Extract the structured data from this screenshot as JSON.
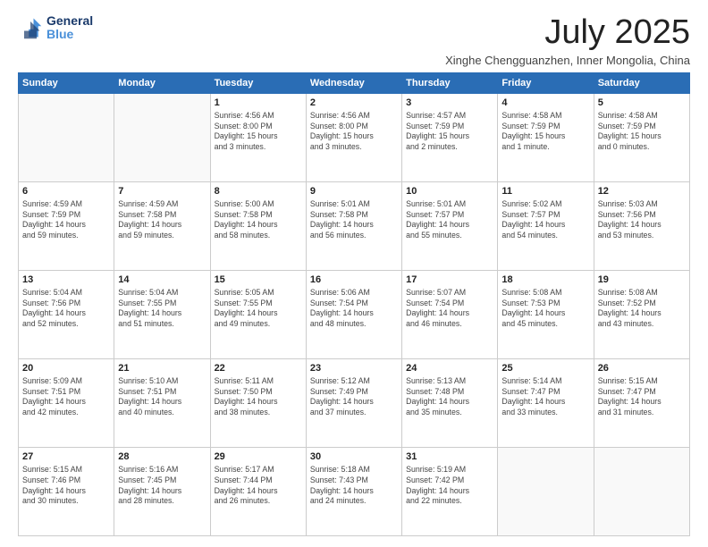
{
  "logo": {
    "line1": "General",
    "line2": "Blue"
  },
  "title": "July 2025",
  "subtitle": "Xinghe Chengguanzhen, Inner Mongolia, China",
  "weekdays": [
    "Sunday",
    "Monday",
    "Tuesday",
    "Wednesday",
    "Thursday",
    "Friday",
    "Saturday"
  ],
  "weeks": [
    [
      {
        "day": null,
        "info": null
      },
      {
        "day": null,
        "info": null
      },
      {
        "day": "1",
        "info": "Sunrise: 4:56 AM\nSunset: 8:00 PM\nDaylight: 15 hours\nand 3 minutes."
      },
      {
        "day": "2",
        "info": "Sunrise: 4:56 AM\nSunset: 8:00 PM\nDaylight: 15 hours\nand 3 minutes."
      },
      {
        "day": "3",
        "info": "Sunrise: 4:57 AM\nSunset: 7:59 PM\nDaylight: 15 hours\nand 2 minutes."
      },
      {
        "day": "4",
        "info": "Sunrise: 4:58 AM\nSunset: 7:59 PM\nDaylight: 15 hours\nand 1 minute."
      },
      {
        "day": "5",
        "info": "Sunrise: 4:58 AM\nSunset: 7:59 PM\nDaylight: 15 hours\nand 0 minutes."
      }
    ],
    [
      {
        "day": "6",
        "info": "Sunrise: 4:59 AM\nSunset: 7:59 PM\nDaylight: 14 hours\nand 59 minutes."
      },
      {
        "day": "7",
        "info": "Sunrise: 4:59 AM\nSunset: 7:58 PM\nDaylight: 14 hours\nand 59 minutes."
      },
      {
        "day": "8",
        "info": "Sunrise: 5:00 AM\nSunset: 7:58 PM\nDaylight: 14 hours\nand 58 minutes."
      },
      {
        "day": "9",
        "info": "Sunrise: 5:01 AM\nSunset: 7:58 PM\nDaylight: 14 hours\nand 56 minutes."
      },
      {
        "day": "10",
        "info": "Sunrise: 5:01 AM\nSunset: 7:57 PM\nDaylight: 14 hours\nand 55 minutes."
      },
      {
        "day": "11",
        "info": "Sunrise: 5:02 AM\nSunset: 7:57 PM\nDaylight: 14 hours\nand 54 minutes."
      },
      {
        "day": "12",
        "info": "Sunrise: 5:03 AM\nSunset: 7:56 PM\nDaylight: 14 hours\nand 53 minutes."
      }
    ],
    [
      {
        "day": "13",
        "info": "Sunrise: 5:04 AM\nSunset: 7:56 PM\nDaylight: 14 hours\nand 52 minutes."
      },
      {
        "day": "14",
        "info": "Sunrise: 5:04 AM\nSunset: 7:55 PM\nDaylight: 14 hours\nand 51 minutes."
      },
      {
        "day": "15",
        "info": "Sunrise: 5:05 AM\nSunset: 7:55 PM\nDaylight: 14 hours\nand 49 minutes."
      },
      {
        "day": "16",
        "info": "Sunrise: 5:06 AM\nSunset: 7:54 PM\nDaylight: 14 hours\nand 48 minutes."
      },
      {
        "day": "17",
        "info": "Sunrise: 5:07 AM\nSunset: 7:54 PM\nDaylight: 14 hours\nand 46 minutes."
      },
      {
        "day": "18",
        "info": "Sunrise: 5:08 AM\nSunset: 7:53 PM\nDaylight: 14 hours\nand 45 minutes."
      },
      {
        "day": "19",
        "info": "Sunrise: 5:08 AM\nSunset: 7:52 PM\nDaylight: 14 hours\nand 43 minutes."
      }
    ],
    [
      {
        "day": "20",
        "info": "Sunrise: 5:09 AM\nSunset: 7:51 PM\nDaylight: 14 hours\nand 42 minutes."
      },
      {
        "day": "21",
        "info": "Sunrise: 5:10 AM\nSunset: 7:51 PM\nDaylight: 14 hours\nand 40 minutes."
      },
      {
        "day": "22",
        "info": "Sunrise: 5:11 AM\nSunset: 7:50 PM\nDaylight: 14 hours\nand 38 minutes."
      },
      {
        "day": "23",
        "info": "Sunrise: 5:12 AM\nSunset: 7:49 PM\nDaylight: 14 hours\nand 37 minutes."
      },
      {
        "day": "24",
        "info": "Sunrise: 5:13 AM\nSunset: 7:48 PM\nDaylight: 14 hours\nand 35 minutes."
      },
      {
        "day": "25",
        "info": "Sunrise: 5:14 AM\nSunset: 7:47 PM\nDaylight: 14 hours\nand 33 minutes."
      },
      {
        "day": "26",
        "info": "Sunrise: 5:15 AM\nSunset: 7:47 PM\nDaylight: 14 hours\nand 31 minutes."
      }
    ],
    [
      {
        "day": "27",
        "info": "Sunrise: 5:15 AM\nSunset: 7:46 PM\nDaylight: 14 hours\nand 30 minutes."
      },
      {
        "day": "28",
        "info": "Sunrise: 5:16 AM\nSunset: 7:45 PM\nDaylight: 14 hours\nand 28 minutes."
      },
      {
        "day": "29",
        "info": "Sunrise: 5:17 AM\nSunset: 7:44 PM\nDaylight: 14 hours\nand 26 minutes."
      },
      {
        "day": "30",
        "info": "Sunrise: 5:18 AM\nSunset: 7:43 PM\nDaylight: 14 hours\nand 24 minutes."
      },
      {
        "day": "31",
        "info": "Sunrise: 5:19 AM\nSunset: 7:42 PM\nDaylight: 14 hours\nand 22 minutes."
      },
      {
        "day": null,
        "info": null
      },
      {
        "day": null,
        "info": null
      }
    ]
  ]
}
